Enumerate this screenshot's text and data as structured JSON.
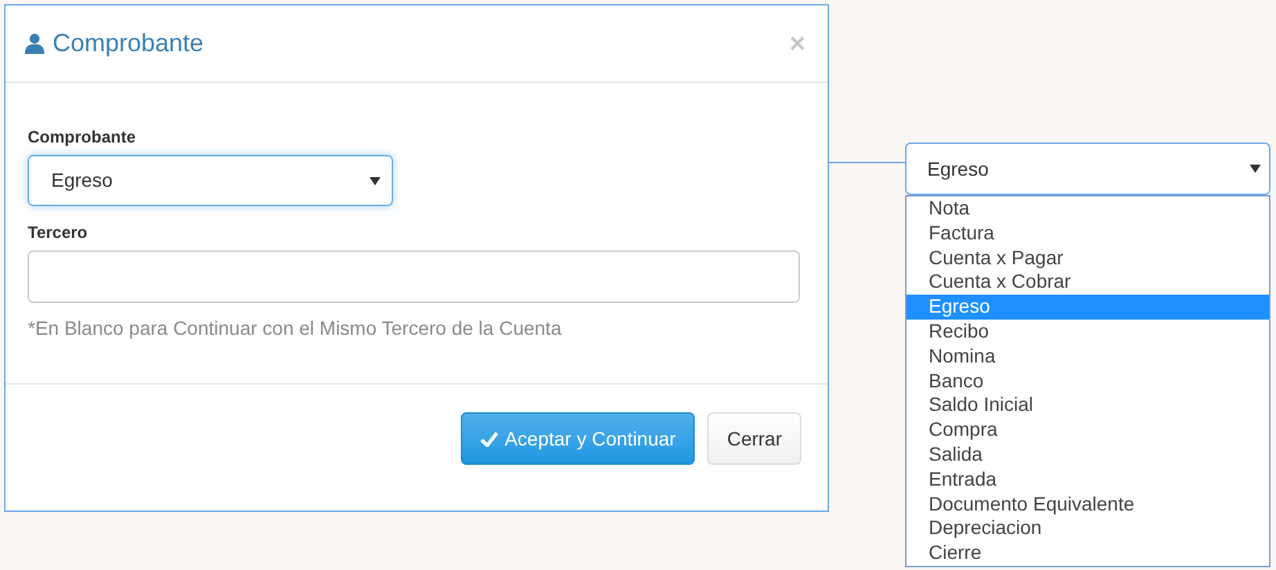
{
  "dialog": {
    "title": "Comprobante",
    "close": "×",
    "fields": [
      {
        "label": "Comprobante",
        "kind": "select",
        "value": "Egreso",
        "focused": true
      },
      {
        "label": "Tercero",
        "kind": "text",
        "focused": false
      }
    ],
    "hint": "*En Blanco para Continuar con el Mismo Tercero de la Cuenta",
    "buttons": [
      {
        "label": "Aceptar y Continuar",
        "kind": "primary"
      },
      {
        "label": "Cerrar",
        "kind": "default"
      }
    ]
  },
  "dropdown": {
    "value": "Egreso",
    "options": [
      {
        "label": "Nota",
        "selected": false
      },
      {
        "label": "Factura",
        "selected": false
      },
      {
        "label": "Cuenta x Pagar",
        "selected": false
      },
      {
        "label": "Cuenta x Cobrar",
        "selected": false
      },
      {
        "label": "Egreso",
        "selected": true
      },
      {
        "label": "Recibo",
        "selected": false
      },
      {
        "label": "Nomina",
        "selected": false
      },
      {
        "label": "Banco",
        "selected": false
      },
      {
        "label": "Saldo Inicial",
        "selected": false
      },
      {
        "label": "Compra",
        "selected": false
      },
      {
        "label": "Salida",
        "selected": false
      },
      {
        "label": "Entrada",
        "selected": false
      },
      {
        "label": "Documento Equivalente",
        "selected": false
      },
      {
        "label": "Depreciacion",
        "selected": false
      },
      {
        "label": "Cierre",
        "selected": false
      }
    ]
  }
}
